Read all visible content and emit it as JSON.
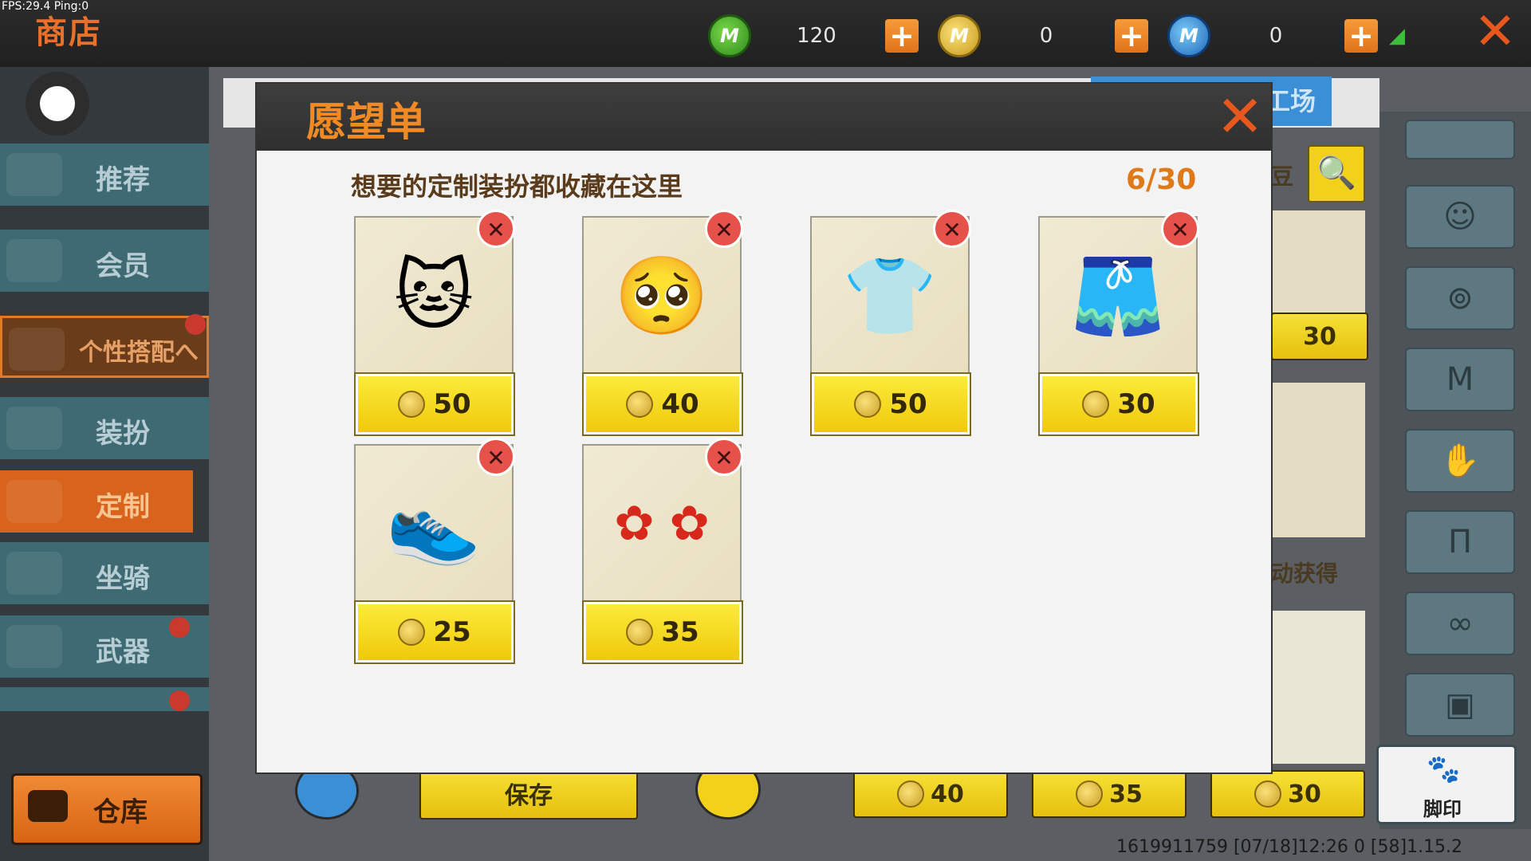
{
  "status": {
    "fps_ping": "FPS:29.4  Ping:0"
  },
  "header": {
    "title": "商店"
  },
  "currencies": [
    {
      "icon": "green-m-coin-icon",
      "value": "120"
    },
    {
      "icon": "gold-m-coin-icon",
      "value": "0"
    },
    {
      "icon": "blue-m-coin-icon",
      "value": "0"
    }
  ],
  "sidebar": {
    "items": [
      {
        "label": "推荐"
      },
      {
        "label": "会员"
      },
      {
        "label": "个性搭配へ"
      },
      {
        "label": "装扮"
      },
      {
        "label": "定制"
      },
      {
        "label": "坐骑"
      },
      {
        "label": "武器"
      }
    ],
    "warehouse": "仓库"
  },
  "background": {
    "tab_partial": "工场",
    "search_partial": "豆",
    "obtain_partial": "动获得",
    "item_price_partial": "30",
    "save_label": "保存",
    "bottom_prices": [
      "40",
      "35",
      "30"
    ],
    "footprint_label": "脚印"
  },
  "wishlist": {
    "title": "愿望单",
    "subtitle": "想要的定制装扮都收藏在这里",
    "count": "6/30",
    "items": [
      {
        "name": "cat-ear-hair",
        "price": "50"
      },
      {
        "name": "crying-face",
        "price": "40"
      },
      {
        "name": "sweater-vest-shirt",
        "price": "50"
      },
      {
        "name": "floral-shorts",
        "price": "30"
      },
      {
        "name": "blue-sneakers",
        "price": "25"
      },
      {
        "name": "red-spider-lily-accessory",
        "price": "35"
      }
    ]
  },
  "footer": {
    "info": "1619911759    [07/18]12:26 0  [58]1.15.2"
  },
  "colors": {
    "accent_orange": "#f08a24",
    "price_yellow": "#f0c90c",
    "remove_red": "#e6524a"
  }
}
